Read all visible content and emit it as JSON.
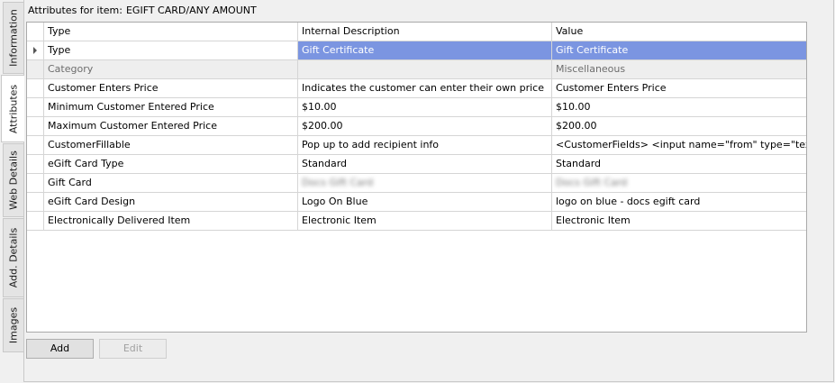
{
  "tabs": [
    {
      "label": "Information",
      "active": false
    },
    {
      "label": "Attributes",
      "active": true
    },
    {
      "label": "Web Details",
      "active": false
    },
    {
      "label": "Add. Details",
      "active": false
    },
    {
      "label": "Images",
      "active": false
    }
  ],
  "title": {
    "label": "Attributes for item:",
    "value": "EGIFT CARD/ANY AMOUNT"
  },
  "grid": {
    "headers": [
      "Type",
      "Internal Description",
      "Value"
    ],
    "rows": [
      {
        "type": "Type",
        "internal": "Gift Certificate",
        "value": "Gift Certificate",
        "state": "selected"
      },
      {
        "type": "Category",
        "internal": "",
        "value": "Miscellaneous",
        "state": "disabled"
      },
      {
        "type": "Customer Enters Price",
        "internal": "Indicates the customer can enter their own price",
        "value": "Customer Enters Price",
        "state": "normal"
      },
      {
        "type": "Minimum Customer Entered Price",
        "internal": "$10.00",
        "value": "$10.00",
        "state": "normal"
      },
      {
        "type": "Maximum Customer Entered Price",
        "internal": "$200.00",
        "value": "$200.00",
        "state": "normal"
      },
      {
        "type": "CustomerFillable",
        "internal": "Pop up to add recipient info",
        "value": "<CustomerFields> <input name=\"from\" type=\"text\" ...",
        "state": "normal"
      },
      {
        "type": "eGift Card Type",
        "internal": "Standard",
        "value": "Standard",
        "state": "normal"
      },
      {
        "type": "Gift Card",
        "internal": "Docs Gift Card",
        "value": "Docs Gift Card",
        "state": "blurred"
      },
      {
        "type": "eGift Card Design",
        "internal": "Logo On Blue",
        "value": "logo on blue - docs egift card",
        "state": "normal"
      },
      {
        "type": "Electronically Delivered Item",
        "internal": "Electronic Item",
        "value": "Electronic Item",
        "state": "normal"
      }
    ]
  },
  "buttons": {
    "add": "Add",
    "edit": "Edit"
  },
  "colors": {
    "selection": "#7b95e1",
    "disabled_row": "#eeeeee",
    "background": "#f0f0f0"
  }
}
